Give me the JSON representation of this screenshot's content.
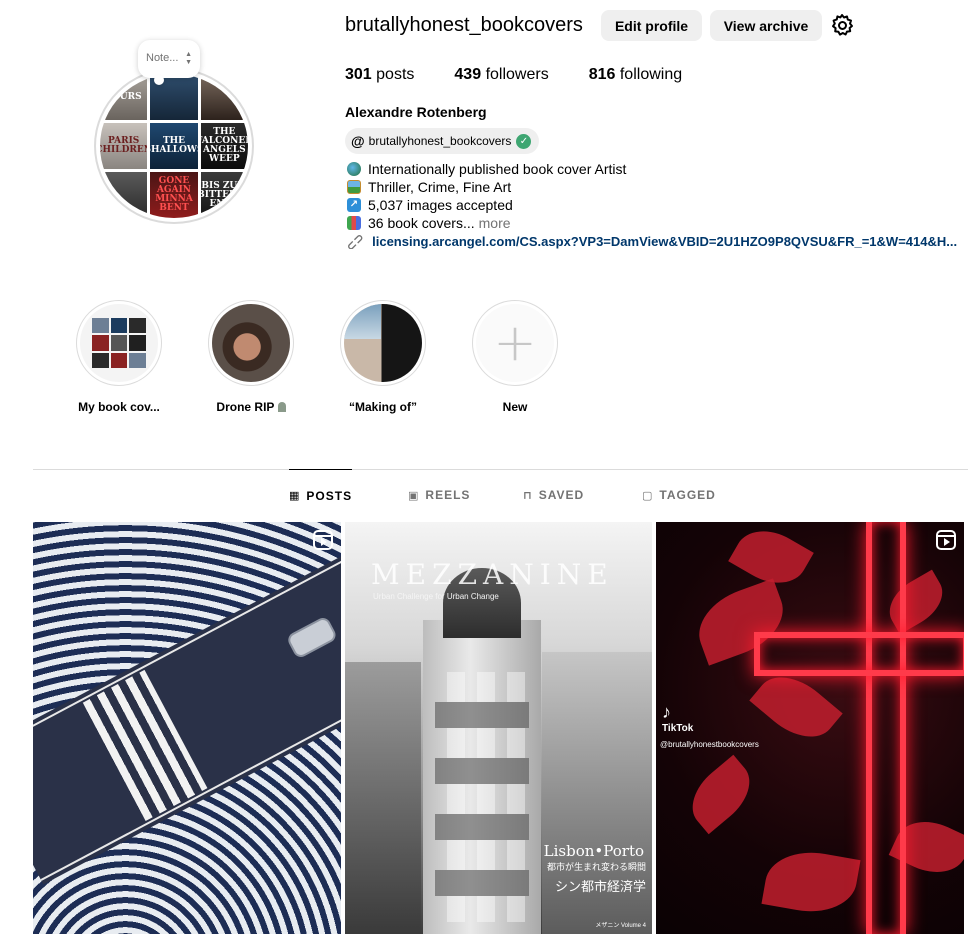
{
  "profile": {
    "username": "brutallyhonest_bookcovers",
    "edit_profile_label": "Edit profile",
    "view_archive_label": "View archive",
    "note_placeholder": "Note...",
    "stats": {
      "posts_count": "301",
      "posts_label": "posts",
      "followers_count": "439",
      "followers_label": "followers",
      "following_count": "816",
      "following_label": "following"
    },
    "full_name": "Alexandre Rotenberg",
    "threads_handle": "brutallyhonest_bookcovers",
    "bio": [
      {
        "icon": "globe-icon",
        "text": "Internationally published book cover Artist"
      },
      {
        "icon": "framed-picture-icon",
        "text": "Thriller, Crime, Fine Art"
      },
      {
        "icon": "up-right-arrow-icon",
        "text": "5,037 images accepted"
      },
      {
        "icon": "books-icon",
        "text": "36 book covers..."
      }
    ],
    "more_label": "more",
    "link": "licensing.arcangel.com/CS.aspx?VP3=DamView&VBID=2U1HZO9P8QVSU&FR_=1&W=414&H..."
  },
  "avatar_covers": [
    "ECURS",
    "",
    "",
    "PARIS CHILDREN",
    "THE SHALLOWS",
    "THE FALCONER ANGELS WEEP",
    "",
    "GONE AGAIN MINNA BENT",
    "BIS ZUM BITTEREN ENDE"
  ],
  "highlights": [
    {
      "label": "My book cov..."
    },
    {
      "label": "Drone RIP"
    },
    {
      "label": "“Making of”"
    },
    {
      "label": "New"
    }
  ],
  "tabs": {
    "posts": "POSTS",
    "reels": "REELS",
    "saved": "SAVED",
    "tagged": "TAGGED"
  },
  "posts": {
    "mezzanine_title": "MEZZANINE",
    "mezzanine_subtitle": "Urban Challenge for Urban Change",
    "lisbon_porto": "Lisbon•Porto",
    "japanese_line1": "都市が生まれ変わる瞬間",
    "japanese_line2": "シン都市経済学",
    "volume_label": "メザニン Volume 4",
    "tiktok_label": "TikTok",
    "tiktok_handle": "@brutallyhonestbookcovers"
  },
  "colors": {
    "link": "#00376b",
    "button_bg": "#efefef",
    "verified": "#3ea672",
    "muted": "#737373"
  }
}
